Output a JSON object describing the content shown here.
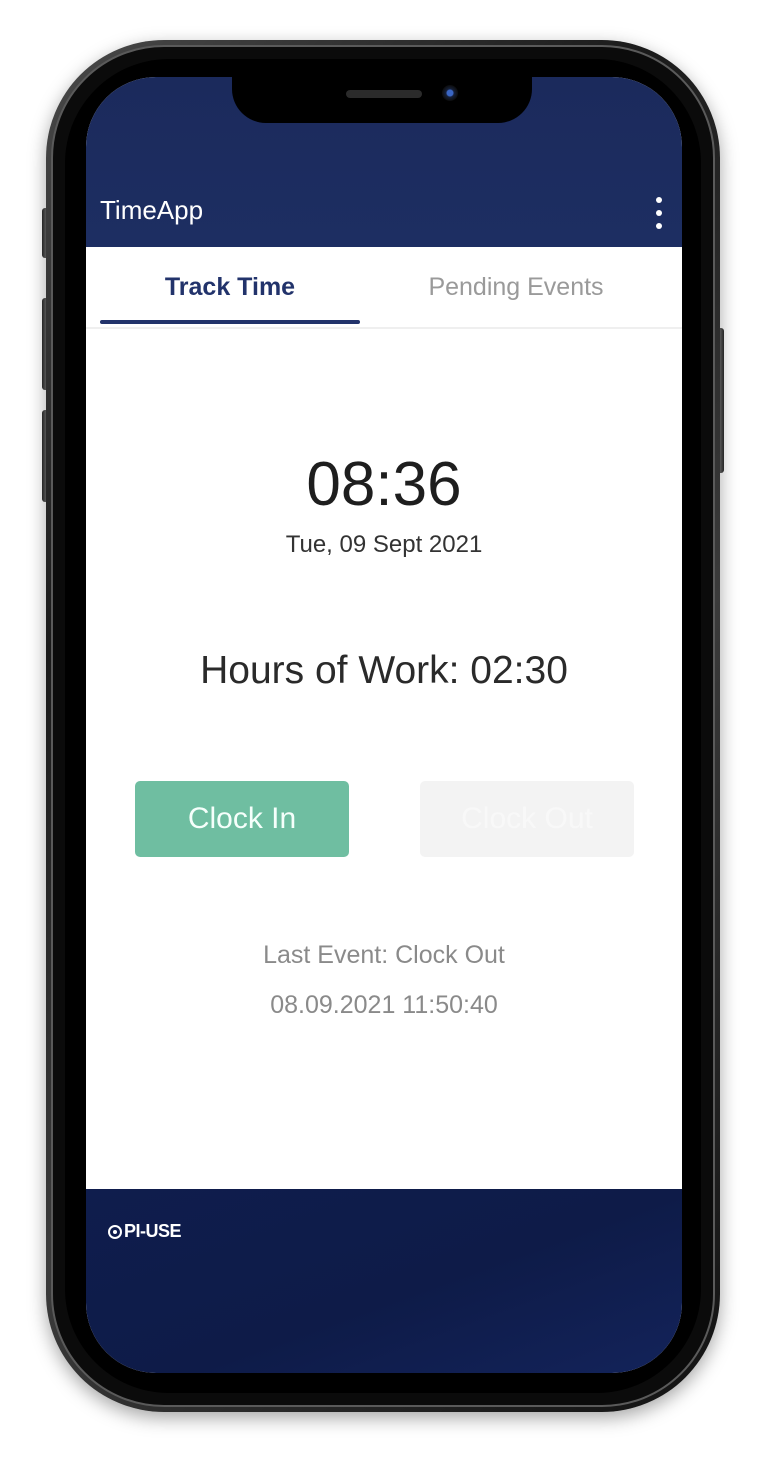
{
  "app": {
    "title": "TimeApp",
    "menu_icon": "kebab-menu-icon"
  },
  "tabs": [
    {
      "label": "Track Time",
      "active": true
    },
    {
      "label": "Pending Events",
      "active": false
    }
  ],
  "clock": {
    "time": "08:36",
    "date": "Tue, 09 Sept 2021"
  },
  "hours": {
    "text": "Hours of Work: 02:30"
  },
  "buttons": {
    "clock_in": "Clock In",
    "clock_out": "Clock Out"
  },
  "last_event": {
    "label": "Last Event: Clock Out",
    "timestamp": "08.09.2021 11:50:40"
  },
  "footer": {
    "logo_text": "PI-USE",
    "logo_icon": "brand-logo-icon"
  },
  "colors": {
    "header": "#1d2e62",
    "accent_tab": "#22336b",
    "clock_in": "#6fbea1",
    "clock_out_disabled": "#f3f3f3",
    "footer": "#0f1d4d"
  }
}
